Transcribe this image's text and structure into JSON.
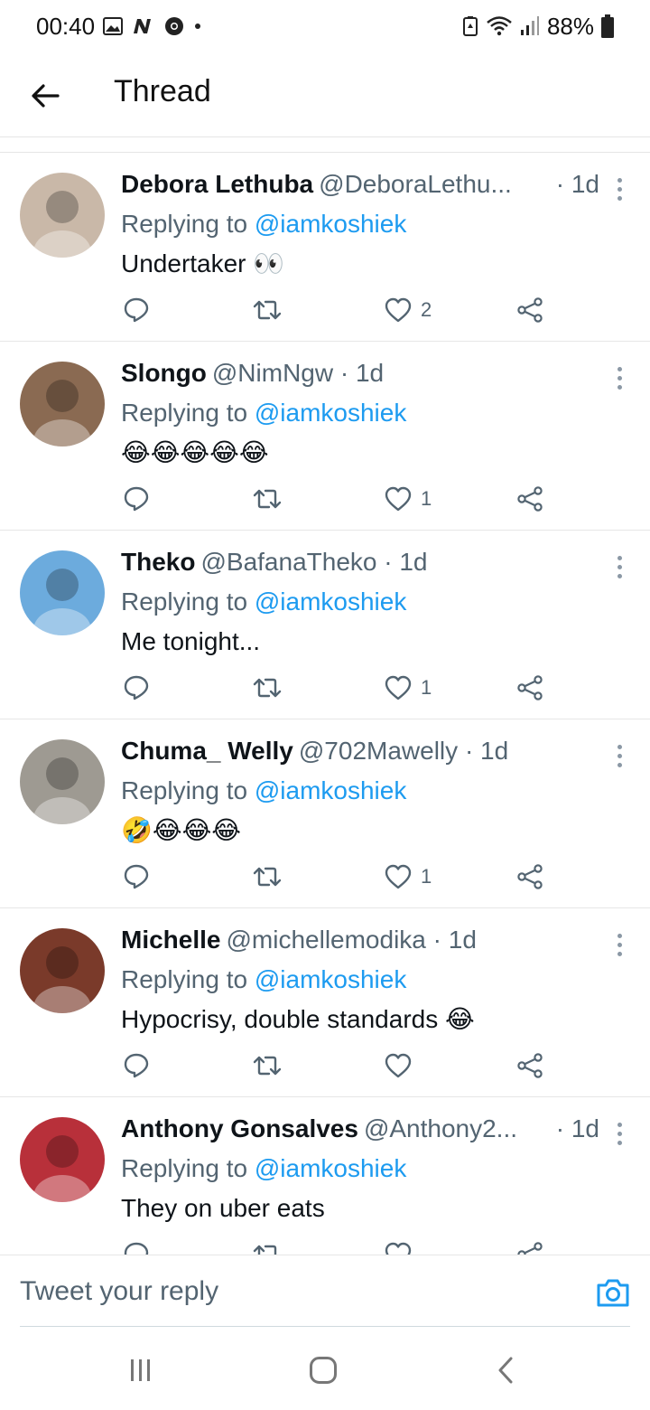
{
  "status_bar": {
    "time": "00:40",
    "battery": "88%",
    "icons": [
      "gallery-icon",
      "n-app-icon",
      "chrome-icon",
      "dot-icon",
      "battery-saver-icon",
      "wifi-icon",
      "signal-icon",
      "battery-icon"
    ]
  },
  "header": {
    "title": "Thread",
    "back_icon": "arrow-left-icon"
  },
  "colors": {
    "accent": "#1d9bf0",
    "secondary_text": "#536471",
    "divider": "#e6e6e6"
  },
  "tweets": [
    {
      "name": "Debora Lethuba",
      "handle": "@DeboraLethu...",
      "time": "· 1d",
      "replying_prefix": "Replying to ",
      "mention": "@iamkoshiek",
      "text": "Undertaker 👀",
      "likes": "2",
      "avatar_color": "#c9b8a8"
    },
    {
      "name": "Slongo",
      "handle": "@NimNgw",
      "time": "· 1d",
      "replying_prefix": "Replying to ",
      "mention": "@iamkoshiek",
      "text": "😂😂😂😂😂",
      "likes": "1",
      "avatar_color": "#8a6a52"
    },
    {
      "name": "Theko",
      "handle": "@BafanaTheko",
      "time": "· 1d",
      "replying_prefix": "Replying to ",
      "mention": "@iamkoshiek",
      "text": "Me tonight...",
      "likes": "1",
      "avatar_color": "#6cabdd"
    },
    {
      "name": "Chuma_ Welly",
      "handle": "@702Mawelly",
      "time": "· 1d",
      "replying_prefix": "Replying to ",
      "mention": "@iamkoshiek",
      "text": "🤣😂😂😂",
      "likes": "1",
      "avatar_color": "#9e9a92"
    },
    {
      "name": "Michelle",
      "handle": "@michellemodika",
      "time": "· 1d",
      "replying_prefix": "Replying to ",
      "mention": "@iamkoshiek",
      "text": "Hypocrisy, double standards 😂",
      "likes": "",
      "avatar_color": "#7a3a2a"
    },
    {
      "name": "Anthony Gonsalves",
      "handle": "@Anthony2...",
      "time": "· 1d",
      "replying_prefix": "Replying to ",
      "mention": "@iamkoshiek",
      "text": "They on uber eats",
      "likes": "",
      "avatar_color": "#b8303a"
    }
  ],
  "composer": {
    "placeholder": "Tweet your reply",
    "camera_icon": "camera-icon"
  },
  "navbar": {
    "icons": [
      "recents-icon",
      "home-icon",
      "back-icon"
    ]
  }
}
